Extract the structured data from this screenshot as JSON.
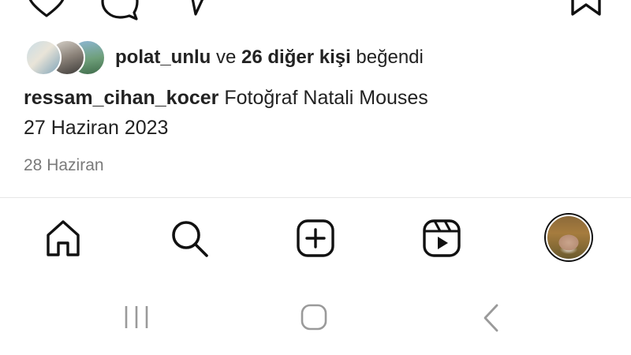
{
  "likes": {
    "user": "polat_unlu",
    "connector": " ve ",
    "others": "26 diğer kişi",
    "suffix": " beğendi"
  },
  "caption": {
    "username": "ressam_cihan_kocer",
    "text": " Fotoğraf Natali Mouses",
    "line2": "27 Haziran 2023"
  },
  "post_date": "28 Haziran",
  "action_bar": {
    "icons": [
      "heart-icon",
      "comment-icon",
      "share-icon",
      "bookmark-icon"
    ]
  },
  "tab_bar": {
    "icons": [
      "home-icon",
      "search-icon",
      "create-icon",
      "reels-icon",
      "profile-avatar"
    ]
  },
  "system_nav": {
    "icons": [
      "recent-apps-icon",
      "home-button-icon",
      "back-icon"
    ]
  },
  "colors": {
    "text": "#222222",
    "muted": "#7a7a7a",
    "divider": "#e6e6e6",
    "icon": "#111111",
    "system_icon": "#9a9a9a"
  }
}
